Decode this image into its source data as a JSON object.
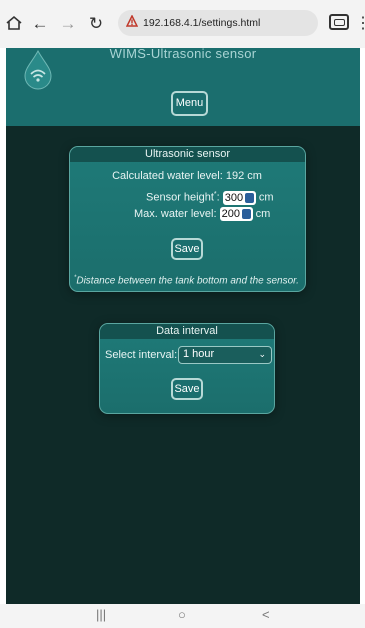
{
  "browser": {
    "url": "192.168.4.1/settings.html",
    "icons": [
      "home-icon",
      "back-icon",
      "forward-icon",
      "reload-icon",
      "lock-icon",
      "tab-switcher-icon",
      "more-menu-icon"
    ]
  },
  "header": {
    "title": "WIMS-Ultrasonic sensor",
    "menu_label": "Menu"
  },
  "ultrasonic": {
    "title": "Ultrasonic sensor",
    "calc_label": "Calculated water level:",
    "calc_value": "192 cm",
    "sensor_height_label": "Sensor height",
    "sensor_height_marker": "*",
    "sensor_height_value": "300",
    "max_level_label": "Max. water level:",
    "max_level_value": "200",
    "unit": "cm",
    "save_label": "Save",
    "note_marker": "*",
    "note_text": "Distance between the tank bottom and the sensor."
  },
  "interval": {
    "title": "Data interval",
    "select_label": "Select interval:",
    "selected": "1 hour",
    "save_label": "Save"
  },
  "colors": {
    "header": "#1b6e6e",
    "background": "#0f2a28",
    "card": "#1f7a78"
  }
}
